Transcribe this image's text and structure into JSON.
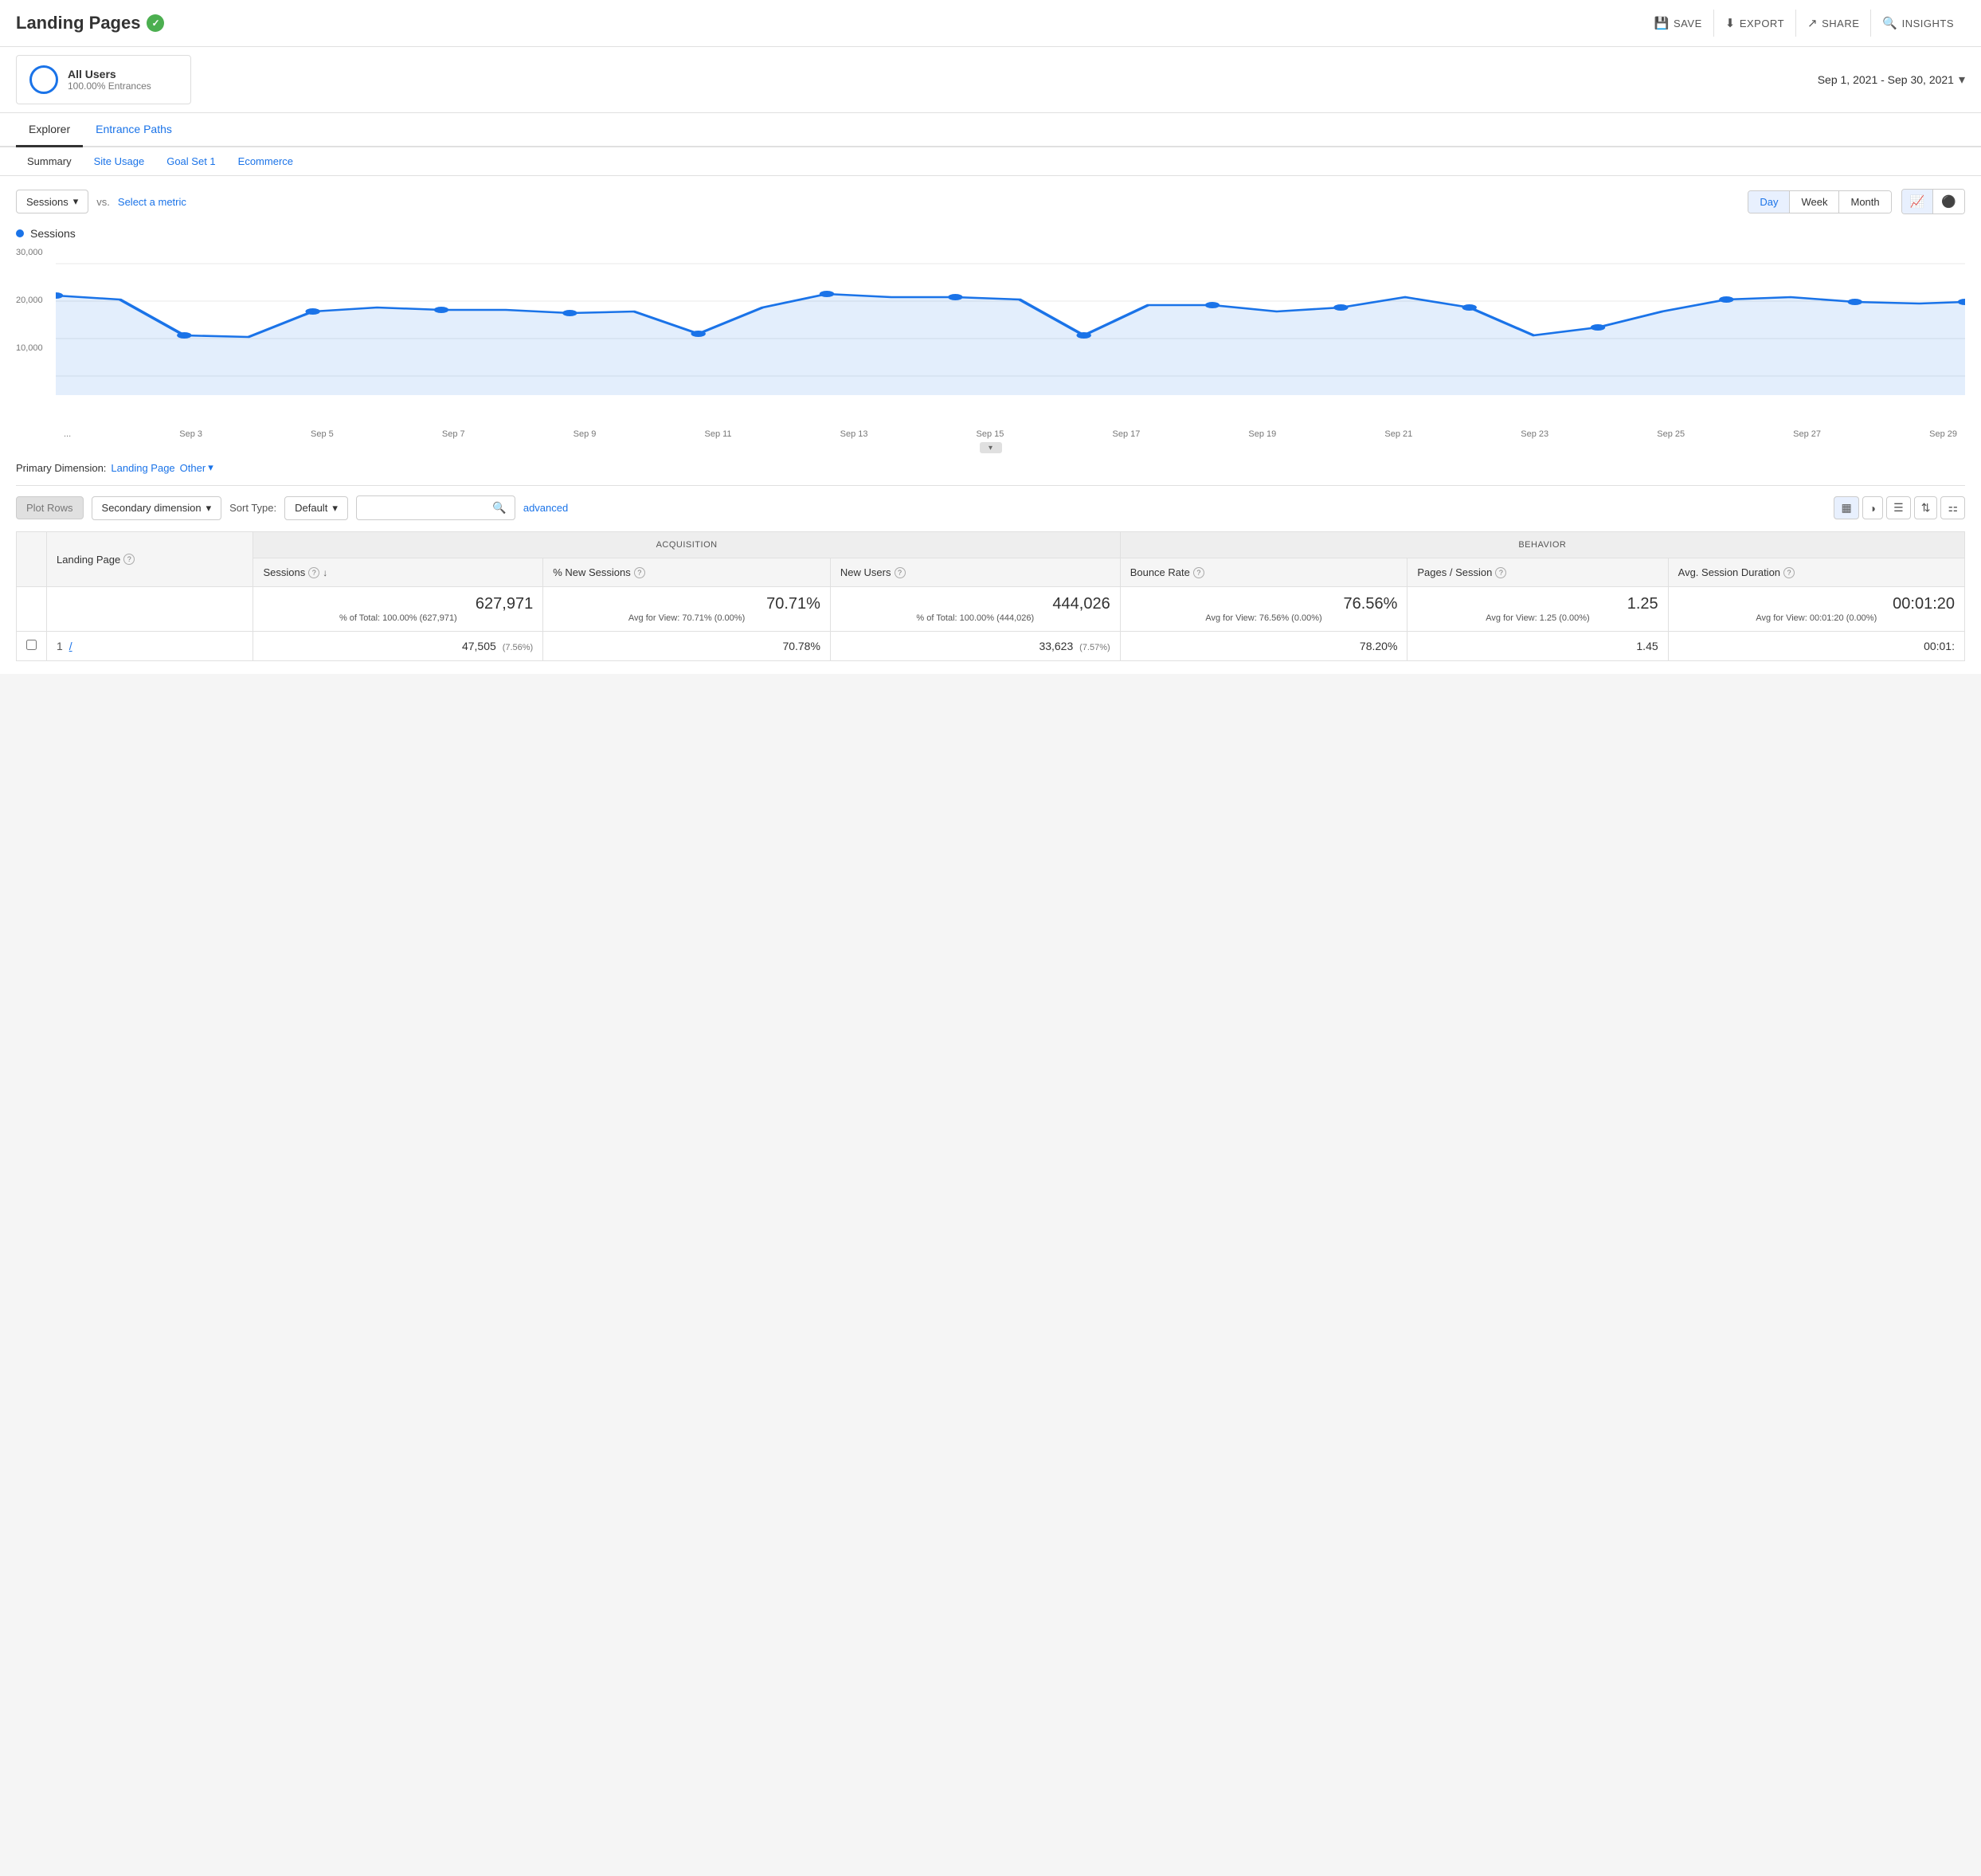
{
  "header": {
    "title": "Landing Pages",
    "save_label": "SAVE",
    "export_label": "EXPORT",
    "share_label": "SHARE",
    "insights_label": "INSIGHTS"
  },
  "segment": {
    "name": "All Users",
    "sub": "100.00% Entrances"
  },
  "date_range": "Sep 1, 2021 - Sep 30, 2021",
  "tabs": [
    {
      "label": "Explorer",
      "active": true
    },
    {
      "label": "Entrance Paths",
      "active": false
    }
  ],
  "sub_tabs": [
    {
      "label": "Summary",
      "active": true
    },
    {
      "label": "Site Usage",
      "active": false
    },
    {
      "label": "Goal Set 1",
      "active": false
    },
    {
      "label": "Ecommerce",
      "active": false
    }
  ],
  "chart": {
    "metric_label": "Sessions",
    "vs_label": "vs.",
    "select_metric": "Select a metric",
    "time_buttons": [
      "Day",
      "Week",
      "Month"
    ],
    "active_time": "Day",
    "y_labels": [
      "30,000",
      "20,000",
      "10,000"
    ],
    "x_labels": [
      "...",
      "Sep 3",
      "Sep 5",
      "Sep 7",
      "Sep 9",
      "Sep 11",
      "Sep 13",
      "Sep 15",
      "Sep 17",
      "Sep 19",
      "Sep 21",
      "Sep 23",
      "Sep 25",
      "Sep 27",
      "Sep 29"
    ],
    "legend": "Sessions"
  },
  "primary_dimension": {
    "label": "Primary Dimension:",
    "name": "Landing Page",
    "other": "Other"
  },
  "table_controls": {
    "plot_rows": "Plot Rows",
    "secondary_dim": "Secondary dimension",
    "sort_type_label": "Sort Type:",
    "sort_type": "Default",
    "advanced": "advanced"
  },
  "table": {
    "col_landing_page": "Landing Page",
    "acquisition_label": "Acquisition",
    "behavior_label": "Behavior",
    "col_sessions": "Sessions",
    "col_pct_new_sessions": "% New Sessions",
    "col_new_users": "New Users",
    "col_bounce_rate": "Bounce Rate",
    "col_pages_per_session": "Pages / Session",
    "col_avg_session_duration": "Avg. Session Duration",
    "total": {
      "sessions": "627,971",
      "sessions_sub": "% of Total: 100.00% (627,971)",
      "pct_new_sessions": "70.71%",
      "pct_new_sessions_sub": "Avg for View: 70.71% (0.00%)",
      "new_users": "444,026",
      "new_users_sub": "% of Total: 100.00% (444,026)",
      "bounce_rate": "76.56%",
      "bounce_rate_sub": "Avg for View: 76.56% (0.00%)",
      "pages_per_session": "1.25",
      "pages_per_session_sub": "Avg for View: 1.25 (0.00%)",
      "avg_session_duration": "00:01:20",
      "avg_session_duration_sub": "Avg for View: 00:01:20 (0.00%)"
    },
    "row1": {
      "number": "1",
      "landing_page": "/",
      "sessions": "47,505",
      "sessions_pct": "(7.56%)",
      "pct_new_sessions": "70.78%",
      "new_users": "33,623",
      "new_users_pct": "(7.57%)",
      "bounce_rate": "78.20%",
      "pages_per_session": "1.45",
      "avg_session_duration": "00:01:"
    }
  }
}
